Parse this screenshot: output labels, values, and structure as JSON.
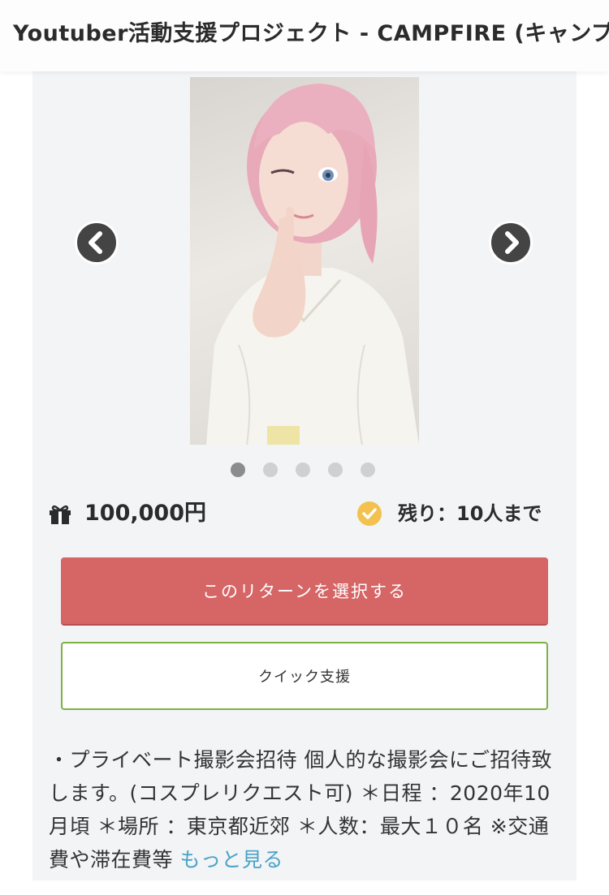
{
  "header": {
    "title": "Youtuber活動支援プロジェクト - CAMPFIRE (キャンプファイヤー)"
  },
  "carousel": {
    "prev_icon": "chevron-left-icon",
    "next_icon": "chevron-right-icon",
    "dot_count": 5,
    "active_index": 0
  },
  "reward": {
    "gift_icon": "gift-icon",
    "price": "100,000円",
    "check_icon": "check-circle-icon",
    "remaining": "残り：10人まで"
  },
  "actions": {
    "select_label": "このリターンを選択する",
    "quick_label": "クイック支援"
  },
  "description": {
    "text": "・プライベート撮影会招待 個人的な撮影会にご招待致します。(コスプレリクエスト可) ＊日程 ：2020年10月頃 ＊場所 ：東京都近郊 ＊人数：最大１０名 ※交通費や滞在費等 ",
    "more_label": "もっと見る"
  },
  "colors": {
    "select_button": "#d66565",
    "quick_border": "#7cb342",
    "check_icon": "#f2c14e",
    "link": "#4aa3c8",
    "card_bg": "#f3f4f6"
  }
}
